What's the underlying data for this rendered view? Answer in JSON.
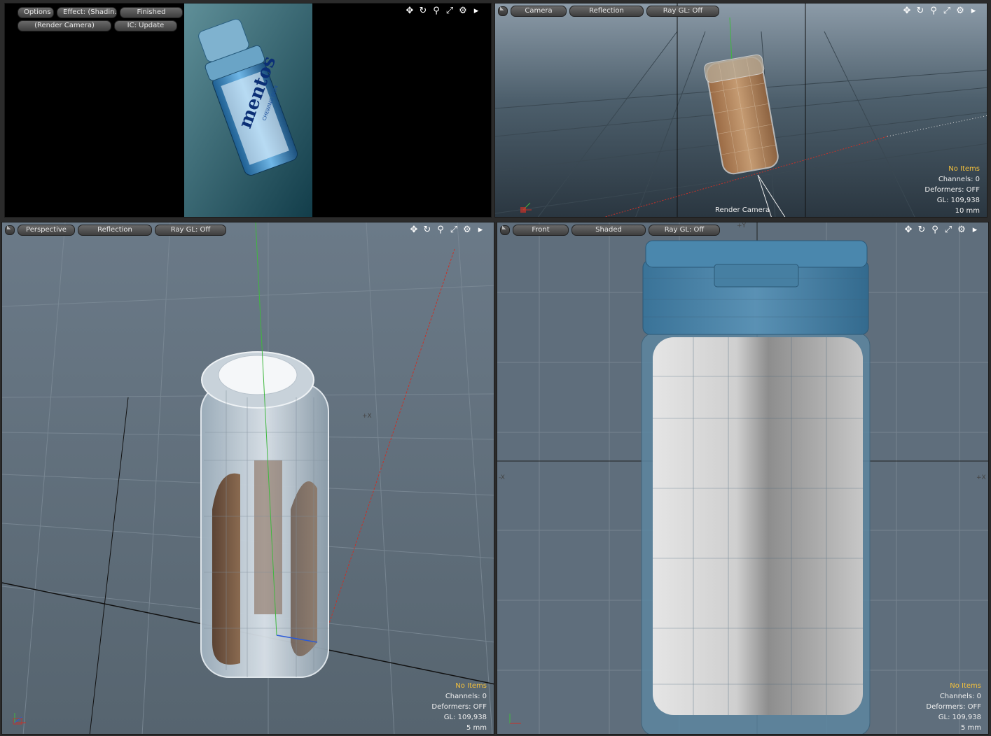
{
  "render_view": {
    "options_label": "Options",
    "effect_label": "Effect: (Shadin...",
    "status_label": "Finished",
    "camera_label": "(Render Camera)",
    "ic_label": "IC: Update",
    "product_brand": "mentos",
    "product_subtitle": "CHEWING GUM"
  },
  "camera_view": {
    "view_label": "Camera",
    "shading_label": "Reflection",
    "raygl_label": "Ray GL: Off",
    "render_camera_label": "Render Camera",
    "info": {
      "no_items": "No Items",
      "channels": "Channels: 0",
      "deformers": "Deformers: OFF",
      "gl": "GL: 109,938",
      "scale": "10 mm"
    }
  },
  "perspective_view": {
    "view_label": "Perspective",
    "shading_label": "Reflection",
    "raygl_label": "Ray GL: Off",
    "axis_x_label": "+X",
    "info": {
      "no_items": "No Items",
      "channels": "Channels: 0",
      "deformers": "Deformers: OFF",
      "gl": "GL: 109,938",
      "scale": "5 mm"
    }
  },
  "front_view": {
    "view_label": "Front",
    "shading_label": "Shaded",
    "raygl_label": "Ray GL: Off",
    "axis_top_label": "+Y",
    "axis_left_label": "-X",
    "axis_right_label": "+X",
    "info": {
      "no_items": "No Items",
      "channels": "Channels: 0",
      "deformers": "Deformers: OFF",
      "gl": "GL: 109,938",
      "scale": "5 mm"
    }
  },
  "viewport_icons": [
    "move-icon",
    "rotate-icon",
    "zoom-icon",
    "maximize-icon",
    "gear-icon",
    "arrow-right-icon"
  ],
  "colors": {
    "viewport_bg": "#5d6d7e",
    "render_bg": "#000000",
    "label_yellow": "#f3c03c",
    "axis_red": "#c83228",
    "axis_green": "#3fb83f",
    "axis_blue": "#2a5ad8",
    "cap_blue": "#3d7fa3"
  }
}
